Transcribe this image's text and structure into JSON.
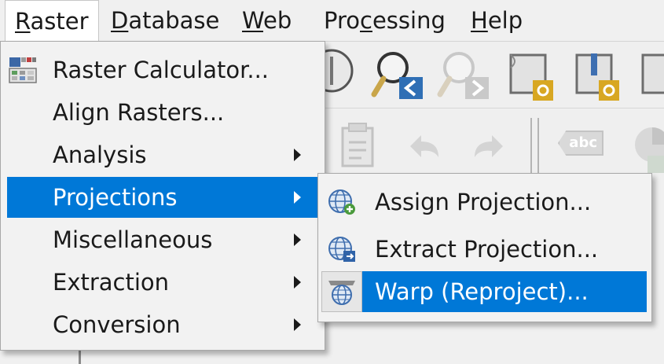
{
  "menubar": {
    "items": [
      {
        "pre": "",
        "key": "R",
        "rest": "aster"
      },
      {
        "pre": "",
        "key": "D",
        "rest": "atabase"
      },
      {
        "pre": "",
        "key": "W",
        "rest": "eb"
      },
      {
        "pre": "Pro",
        "key": "c",
        "rest": "essing"
      },
      {
        "pre": "",
        "key": "H",
        "rest": "elp"
      }
    ]
  },
  "raster_menu": {
    "items": [
      {
        "label": "Raster Calculator...",
        "icon": "raster-calculator-icon",
        "submenu": false
      },
      {
        "label": "Align Rasters...",
        "submenu": false
      },
      {
        "label": "Analysis",
        "submenu": true
      },
      {
        "label": "Projections",
        "submenu": true,
        "highlighted": true
      },
      {
        "label": "Miscellaneous",
        "submenu": true
      },
      {
        "label": "Extraction",
        "submenu": true
      },
      {
        "label": "Conversion",
        "submenu": true
      }
    ]
  },
  "projections_menu": {
    "items": [
      {
        "label": "Assign Projection...",
        "icon": "assign-projection-icon"
      },
      {
        "label": "Extract Projection...",
        "icon": "extract-projection-icon"
      },
      {
        "label": "Warp (Reproject)...",
        "icon": "warp-reproject-icon",
        "highlighted": true
      }
    ]
  },
  "toolbar": {
    "label_tool_text": "abc"
  },
  "colors": {
    "selection": "#0078d7",
    "menu_background": "#f2f2f2"
  }
}
